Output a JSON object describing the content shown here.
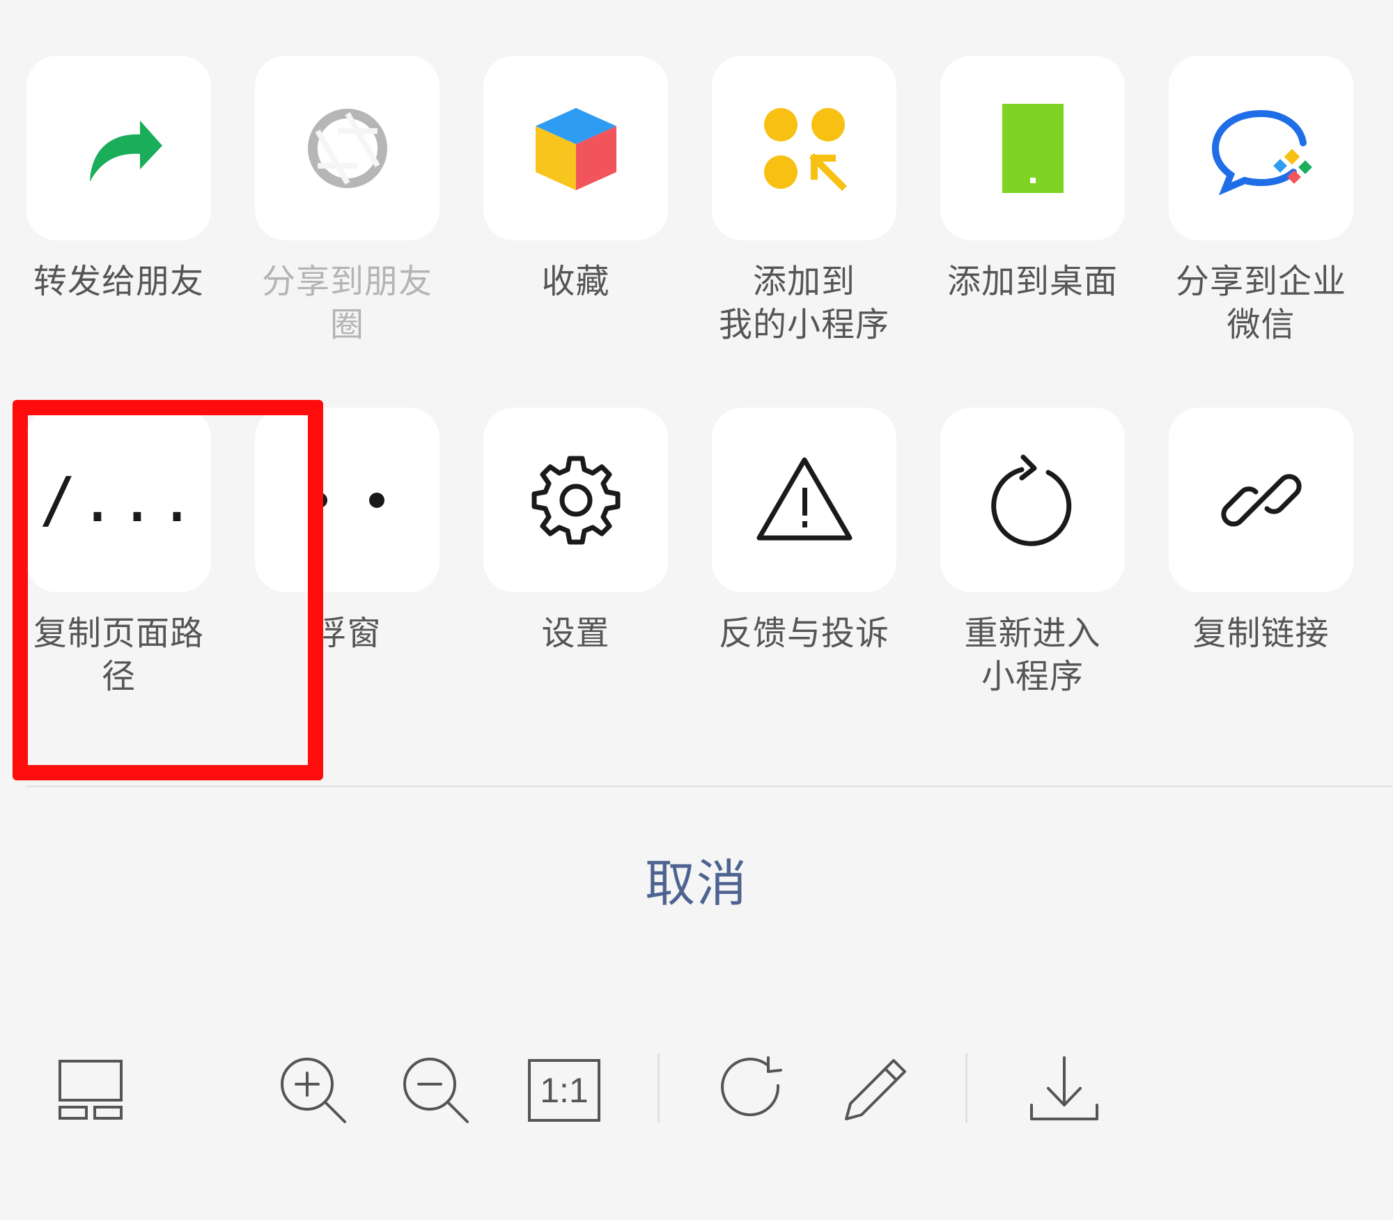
{
  "share_menu": {
    "row1": [
      {
        "label": "转发给朋友",
        "icon": "forward-arrow-icon",
        "disabled": false
      },
      {
        "label": "分享到朋友圈",
        "icon": "moments-aperture-icon",
        "disabled": true
      },
      {
        "label": "收藏",
        "icon": "favorites-cube-icon",
        "disabled": false
      },
      {
        "label": "添加到\n我的小程序",
        "icon": "my-miniprogram-icon",
        "disabled": false
      },
      {
        "label": "添加到桌面",
        "icon": "add-to-desktop-icon",
        "disabled": false
      },
      {
        "label": "分享到企业\n微信",
        "icon": "wecom-icon",
        "disabled": false
      }
    ],
    "row2": [
      {
        "label": "复制页面路\n径",
        "icon": "page-path-icon",
        "glyph": "/...",
        "disabled": false
      },
      {
        "label": "浮窗",
        "icon": "floating-window-icon",
        "disabled": false
      },
      {
        "label": "设置",
        "icon": "gear-icon",
        "disabled": false
      },
      {
        "label": "反馈与投诉",
        "icon": "warning-icon",
        "disabled": false
      },
      {
        "label": "重新进入\n小程序",
        "icon": "reload-icon",
        "disabled": false
      },
      {
        "label": "复制链接",
        "icon": "link-icon",
        "disabled": false
      }
    ],
    "cancel_label": "取消"
  },
  "viewer_toolbar": {
    "fit_label": "1:1",
    "items": [
      "thumbnail-grid-icon",
      "zoom-in-icon",
      "zoom-out-icon",
      "actual-size-icon",
      "rotate-icon",
      "edit-pencil-icon",
      "download-icon"
    ]
  },
  "colors": {
    "background": "#f5f5f5",
    "tile": "#ffffff",
    "label": "#555555",
    "label_disabled": "#b4b4b4",
    "cancel": "#4d6390",
    "highlight": "#ff0d0d",
    "forward_green": "#1aad5a",
    "cube_blue": "#2e9cf2",
    "cube_yellow": "#f7c51e",
    "cube_red": "#f2545b",
    "miniprogram_yellow": "#f8c012",
    "desktop_green": "#7fd322",
    "wecom_blue": "#1f6ee8"
  }
}
